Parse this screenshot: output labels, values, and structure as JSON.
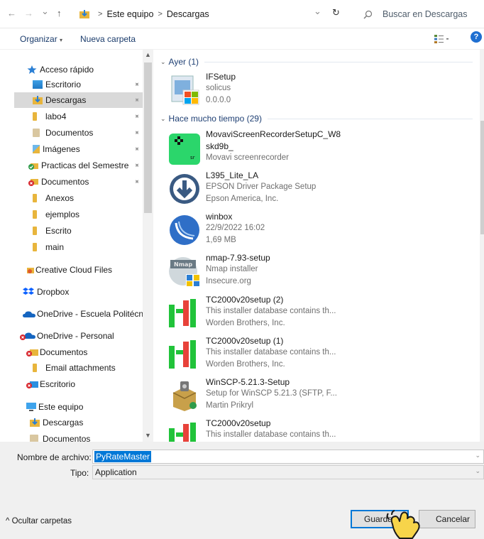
{
  "address_bar": {
    "back": "←",
    "forward": "→",
    "recent": "⌄",
    "up": "↑",
    "path": [
      "Este equipo",
      "Descargas"
    ],
    "separator": ">",
    "refresh": "↻",
    "search_placeholder": "Buscar en Descargas"
  },
  "toolbar": {
    "organize": "Organizar",
    "organize_arrow": "▾",
    "new_folder": "Nueva carpeta",
    "help": "?"
  },
  "nav": {
    "items": [
      {
        "label": "Acceso rápido",
        "icon": "star-icon"
      },
      {
        "label": "Escritorio",
        "icon": "folder-icon",
        "pinned": true
      },
      {
        "label": "Descargas",
        "icon": "download-folder-icon",
        "pinned": true,
        "selected": true
      },
      {
        "label": "labo4",
        "icon": "folder-icon",
        "pinned": true
      },
      {
        "label": "Documentos",
        "icon": "documents-folder-icon",
        "pinned": true
      },
      {
        "label": "Imágenes",
        "icon": "pictures-folder-icon",
        "pinned": true
      },
      {
        "label": "Practicas del Semestre",
        "icon": "synced-folder-icon",
        "pinned": true
      },
      {
        "label": "Documentos",
        "icon": "sync-error-folder-icon",
        "pinned": true
      },
      {
        "label": "Anexos",
        "icon": "folder-icon"
      },
      {
        "label": "ejemplos",
        "icon": "folder-icon"
      },
      {
        "label": "Escrito",
        "icon": "folder-icon"
      },
      {
        "label": "main",
        "icon": "folder-icon"
      },
      {
        "label": "Creative Cloud Files",
        "icon": "creative-cloud-icon"
      },
      {
        "label": "Dropbox",
        "icon": "dropbox-icon"
      },
      {
        "label": "OneDrive - Escuela Politécnica",
        "icon": "onedrive-icon"
      },
      {
        "label": "OneDrive - Personal",
        "icon": "onedrive-error-icon"
      },
      {
        "label": "Documentos",
        "icon": "sync-error-folder-icon"
      },
      {
        "label": "Email attachments",
        "icon": "folder-icon"
      },
      {
        "label": "Escritorio",
        "icon": "sync-error-folder-icon"
      },
      {
        "label": "Este equipo",
        "icon": "computer-icon"
      },
      {
        "label": "Descargas",
        "icon": "download-folder-icon"
      },
      {
        "label": "Documentos",
        "icon": "documents-folder-icon"
      }
    ],
    "pin_glyph": "📌"
  },
  "files": {
    "groups": [
      {
        "label": "Ayer (1)"
      },
      {
        "label": "Hace mucho tiempo (29)"
      }
    ],
    "items": [
      {
        "name": "IFSetup",
        "line2": "solicus",
        "line3": "0.0.0.0",
        "icon": "installer-icon"
      },
      {
        "name": "MovaviScreenRecorderSetupC_W8",
        "name2": "skd9b_",
        "line3": "Movavi screenrecorder",
        "icon": "movavi-icon"
      },
      {
        "name": "L395_Lite_LA",
        "line2": "EPSON Driver Package Setup",
        "line3": "Epson America, Inc.",
        "icon": "download-circle-icon"
      },
      {
        "name": "winbox",
        "line2": "22/9/2022 16:02",
        "line3": "1,69 MB",
        "icon": "winbox-icon"
      },
      {
        "name": "nmap-7.93-setup",
        "line2": "Nmap installer",
        "line3": "Insecure.org",
        "icon": "nmap-icon"
      },
      {
        "name": "TC2000v20setup (2)",
        "line2": "This installer database contains th...",
        "line3": "Worden Brothers, Inc.",
        "icon": "tc2000-icon"
      },
      {
        "name": "TC2000v20setup (1)",
        "line2": "This installer database contains th...",
        "line3": "Worden Brothers, Inc.",
        "icon": "tc2000-icon"
      },
      {
        "name": "WinSCP-5.21.3-Setup",
        "line2": "Setup for WinSCP 5.21.3 (SFTP, F...",
        "line3": "Martin Prikryl",
        "icon": "winscp-icon"
      },
      {
        "name": "TC2000v20setup",
        "line2": "This installer database contains th...",
        "line3": "",
        "icon": "tc2000-icon"
      }
    ]
  },
  "form": {
    "filename_label": "Nombre de archivo:",
    "filename_value": "PyRateMaster",
    "type_label": "Tipo:",
    "type_value": "Application",
    "hide_folders": "Ocultar carpetas",
    "hide_arrow": "^",
    "save_button": "Guardar",
    "cancel_button": "Cancelar"
  },
  "colors": {
    "accent": "#0078d7",
    "folder": "#e8b53c",
    "link_text": "#1e3f73",
    "tc2000_green": "#21c33a",
    "tc2000_red": "#e8423a",
    "movavi_green": "#2bd66b"
  }
}
